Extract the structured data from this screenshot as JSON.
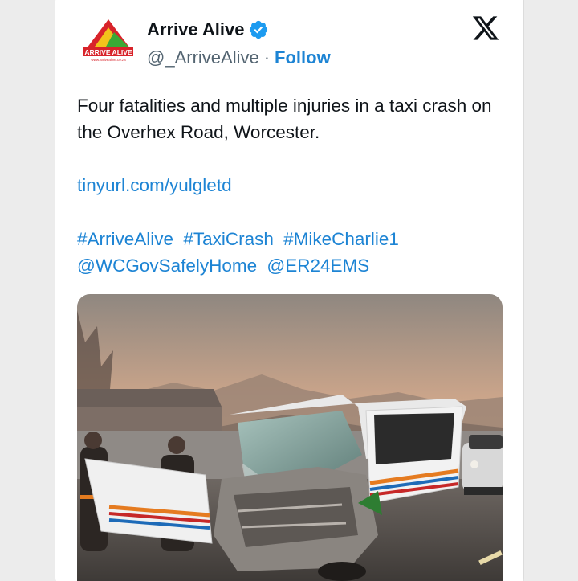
{
  "account": {
    "display_name": "Arrive Alive",
    "handle": "@_ArriveAlive",
    "separator": "·",
    "follow_label": "Follow",
    "logo_text": "ARRIVE ALIVE",
    "logo_url_text": "www.arrivealive.co.za"
  },
  "tweet": {
    "text": "Four fatalities and multiple injuries in a taxi crash on the Overhex Road, Worcester.",
    "link": "tinyurl.com/yulgletd",
    "tags": [
      "#ArriveAlive",
      "#TaxiCrash",
      "#MikeCharlie1",
      "@WCGovSafelyHome",
      "@ER24EMS"
    ]
  },
  "colors": {
    "link": "#1d84d4",
    "verified": "#1d9bf0",
    "text": "#0f1419",
    "muted": "#536471"
  },
  "icons": {
    "verified": "verified-badge-icon",
    "platform": "x-logo-icon"
  }
}
